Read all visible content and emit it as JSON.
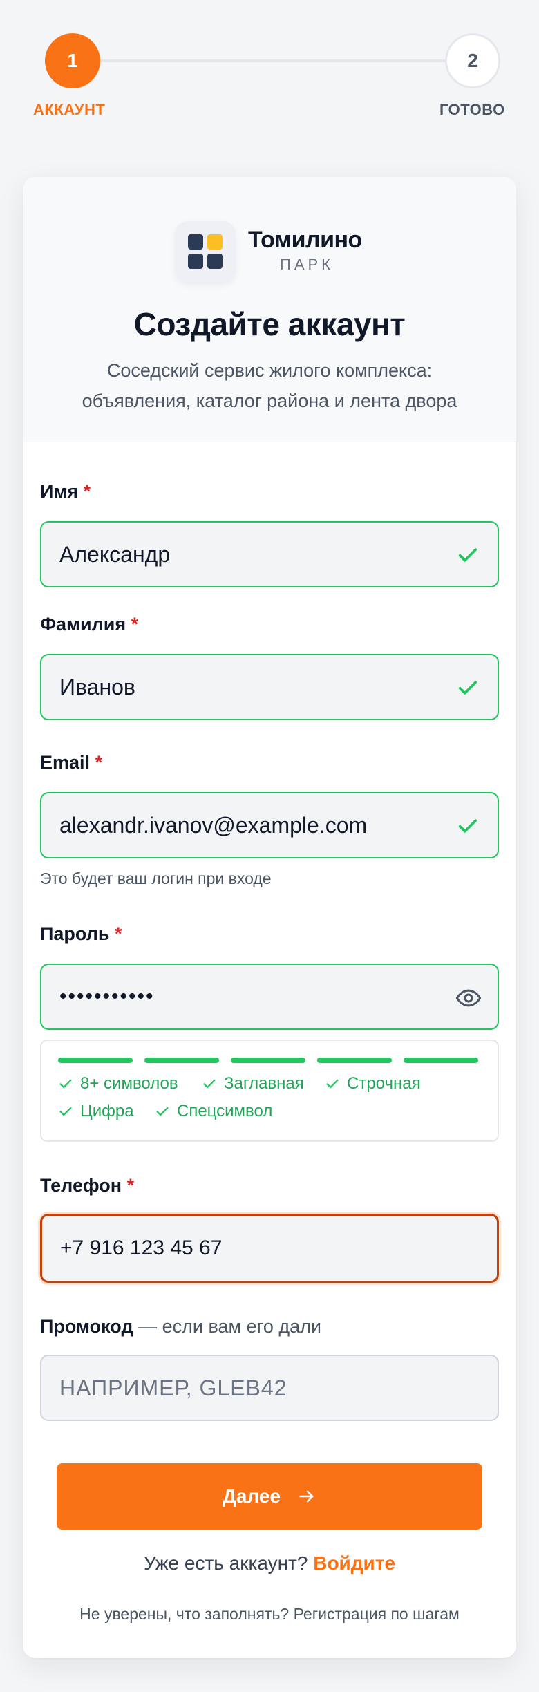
{
  "stepper": {
    "steps": [
      {
        "number": "1",
        "label": "АККАУНТ",
        "state": "active"
      },
      {
        "number": "2",
        "label": "ГОТОВО",
        "state": "upcoming"
      }
    ]
  },
  "brand": {
    "name": "Томилино",
    "sub": "ПАРК",
    "logo_icon": "grid-logo-icon"
  },
  "header": {
    "title": "Создайте аккаунт",
    "description": "Соседский сервис жилого комплекса: объявления, каталог района и лента двора"
  },
  "form": {
    "required_mark": "*",
    "first_name": {
      "label": "Имя",
      "value": "Александр",
      "status": "valid"
    },
    "last_name": {
      "label": "Фамилия",
      "value": "Иванов",
      "status": "valid"
    },
    "email": {
      "label": "Email",
      "value": "alexandr.ivanov@example.com",
      "status": "valid",
      "help": "Это будет ваш логин при входе"
    },
    "password": {
      "label": "Пароль",
      "value": "•••••••••••",
      "status": "valid",
      "strength_segments_filled": 5,
      "strength_segments_total": 5,
      "requirements": [
        "8+ символов",
        "Заглавная",
        "Строчная",
        "Цифра",
        "Спецсимвол"
      ]
    },
    "phone": {
      "label": "Телефон",
      "value": "+7 916 123 45 67",
      "state": "focused"
    },
    "promo": {
      "label": "Промокод",
      "hint": "— если вам его дали",
      "placeholder": "НАПРИМЕР, GLEB42",
      "value": ""
    }
  },
  "actions": {
    "next_label": "Далее",
    "have_account": "Уже есть аккаунт?",
    "login_link": "Войдите",
    "bottom_note": "Не уверены, что заполнять? Регистрация по шагам"
  },
  "colors": {
    "accent": "#f97316",
    "success": "#22c55e",
    "required": "#dc2626",
    "focus_border": "#c2410c",
    "logo_dark": "#2b3a55",
    "logo_yellow": "#fbbf24"
  }
}
